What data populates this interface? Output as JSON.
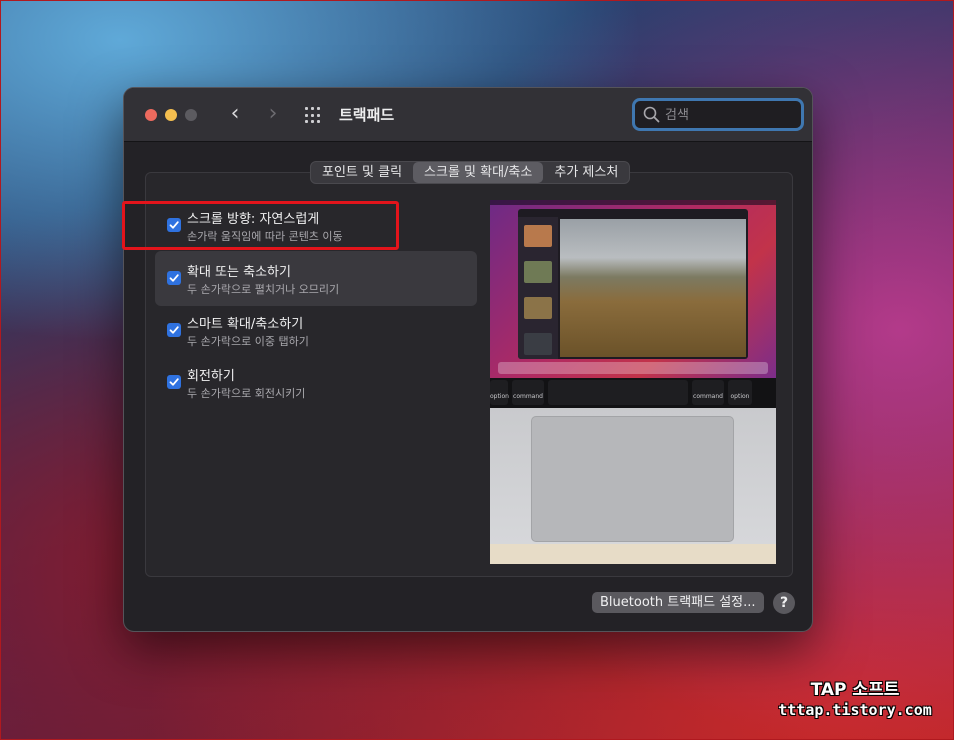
{
  "window": {
    "title": "트랙패드",
    "traffic_lights": [
      "close",
      "minimize",
      "zoom-disabled"
    ],
    "nav": {
      "back_icon": "chevron-left-icon",
      "forward_icon": "chevron-right-icon",
      "grid_icon": "show-all-grid-icon"
    }
  },
  "search": {
    "placeholder": "검색",
    "value": ""
  },
  "tabs": [
    {
      "label": "포인트 및 클릭",
      "selected": false
    },
    {
      "label": "스크롤 및 확대/축소",
      "selected": true
    },
    {
      "label": "추가 제스처",
      "selected": false
    }
  ],
  "options": [
    {
      "title": "스크롤 방향: 자연스럽게",
      "subtitle": "손가락 움직임에 따라 콘텐츠 이동",
      "checked": true,
      "highlighted": false
    },
    {
      "title": "확대 또는 축소하기",
      "subtitle": "두 손가락으로 펼치거나 오므리기",
      "checked": true,
      "highlighted": true
    },
    {
      "title": "스마트 확대/축소하기",
      "subtitle": "두 손가락으로 이중 탭하기",
      "checked": true,
      "highlighted": false
    },
    {
      "title": "회전하기",
      "subtitle": "두 손가락으로 회전시키기",
      "checked": true,
      "highlighted": false
    }
  ],
  "preview": {
    "keys": [
      "option",
      "command",
      "command",
      "option"
    ]
  },
  "footer": {
    "bluetooth_button": "Bluetooth 트랙패드 설정...",
    "help_button": "?"
  },
  "watermark": {
    "title": "TAP 소프트",
    "url": "tttap.tistory.com"
  },
  "colors": {
    "accent": "#2f72e0",
    "annotation_box": "#e3141b",
    "search_focus": "#3f77b0"
  }
}
